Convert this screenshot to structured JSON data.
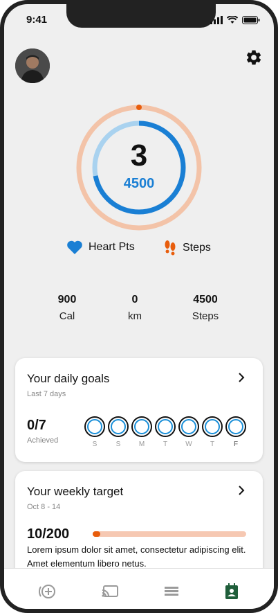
{
  "status": {
    "time": "9:41"
  },
  "ring": {
    "heart_points": "3",
    "steps": "4500",
    "steps_progress": 0.72
  },
  "legend": {
    "heart_label": "Heart Pts",
    "steps_label": "Steps"
  },
  "stats": [
    {
      "value": "900",
      "unit": "Cal"
    },
    {
      "value": "0",
      "unit": "km"
    },
    {
      "value": "4500",
      "unit": "Steps"
    }
  ],
  "daily_goals": {
    "title": "Your daily goals",
    "subtitle": "Last 7 days",
    "achieved": "0/7",
    "achieved_label": "Achieved",
    "days": [
      "S",
      "S",
      "M",
      "T",
      "W",
      "T",
      "F"
    ]
  },
  "weekly_target": {
    "title": "Your weekly target",
    "subtitle": "Oct 8 - 14",
    "value": "10/200",
    "progress": 0.05,
    "description": "Lorem ipsum dolor sit amet, consectetur adipiscing elit. Amet elementum libero netus."
  },
  "colors": {
    "accent_blue": "#1a7fd4",
    "accent_orange": "#e85d0c",
    "ring_peach": "#f3c3a8"
  },
  "nav": {
    "items": [
      "add-activity-icon",
      "cast-icon",
      "journal-icon",
      "profile-icon"
    ],
    "active": "profile-icon"
  }
}
